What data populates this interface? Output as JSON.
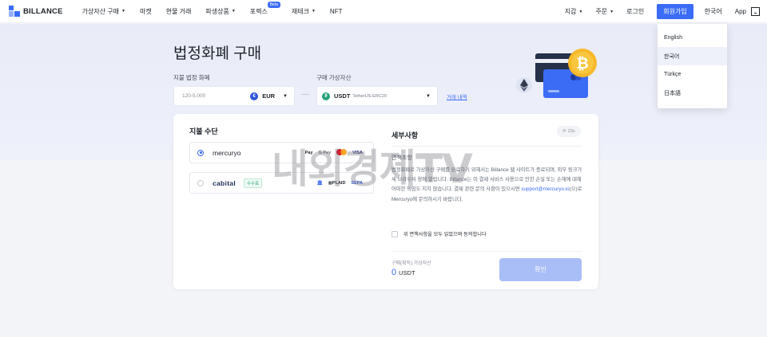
{
  "nav": {
    "brand": "BILLANCE",
    "items": [
      {
        "label": "가상자산 구매",
        "caret": true
      },
      {
        "label": "마켓",
        "caret": false
      },
      {
        "label": "현물 거래",
        "caret": false
      },
      {
        "label": "파생상품",
        "caret": true
      },
      {
        "label": "포렉스",
        "caret": false,
        "badge": "Beta"
      },
      {
        "label": "재테크",
        "caret": true
      },
      {
        "label": "NFT",
        "caret": false
      }
    ],
    "right": {
      "wallet": "지갑",
      "orders": "주문",
      "login": "로그인",
      "signup": "회원가입",
      "language": "한국어",
      "app": "App"
    }
  },
  "buy": {
    "title": "법정화폐 구매",
    "pay_label": "지불 법정 화폐",
    "pay_placeholder": "120-5,000",
    "pay_currency": "EUR",
    "buy_label": "구매 가상자산",
    "buy_coin": "USDT",
    "buy_coin_sub": "TetherUS-ERC20",
    "history_link": "거래 내역"
  },
  "payment": {
    "title": "지불 수단",
    "providers": [
      {
        "name": "mercuryo",
        "selected": true,
        "tag": "",
        "icons": [
          "Pay",
          "G Pay",
          "mastercard",
          "VISA"
        ]
      },
      {
        "name": "cabital",
        "selected": false,
        "tag": "수수료",
        "icons": [
          "bank",
          "PLAID",
          "SEPA"
        ]
      }
    ]
  },
  "details": {
    "title": "세부사항",
    "refresh": "23s",
    "disclaimer_title": "면책조항",
    "disclaimer_text_1": "법정화폐로 가상자산 구매를 완료하기 위해서는 Billance 웹 사이트가 종료되며, 외부 링크가 새 브라우저 창에 열립니다. Billance는 이 결제 서비스 사용으로 인한 손실 또는 손해에 대해 어떠한 책임도 지지 않습니다. 결제 관련 문의 사항이 있으시면 ",
    "disclaimer_email": "support@mercuryo.io",
    "disclaimer_text_2": "(으)로 Mercuryo에 문의하시기 바랍니다.",
    "agree_text": "위 면책사항을 모두 읽었으며 동의합니다",
    "receive_label": "구매(획득) 가상자산",
    "receive_amount": "0",
    "receive_unit": "USDT",
    "confirm": "확인"
  },
  "language_menu": {
    "options": [
      "English",
      "한국어",
      "Türkçe",
      "日本語"
    ],
    "selected": "한국어"
  },
  "watermark": "내외경제TV",
  "colors": {
    "accent": "#3b6cf6",
    "confirm_disabled": "#a9bdf6",
    "hero_bg": "#e9ecf8"
  }
}
